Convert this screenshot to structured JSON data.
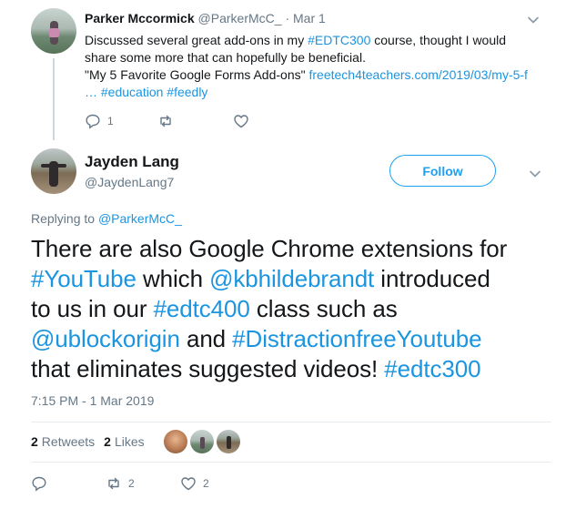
{
  "parent_tweet": {
    "author_name": "Parker Mccormick",
    "author_handle": "@ParkerMcC_",
    "separator": "·",
    "date": "Mar 1",
    "text_lines": [
      {
        "parts": [
          {
            "t": "Discussed several great add-ons in my ",
            "link": false
          },
          {
            "t": "#EDTC300",
            "link": true
          },
          {
            "t": " course, thought I would",
            "link": false
          }
        ]
      },
      {
        "parts": [
          {
            "t": "share some more that can hopefully be beneficial.",
            "link": false
          }
        ]
      },
      {
        "parts": [
          {
            "t": "\"My 5 Favorite Google Forms Add-ons\" ",
            "link": false
          },
          {
            "t": "freetech4teachers.com/2019/03/my-5-f",
            "link": true
          }
        ]
      },
      {
        "parts": [
          {
            "t": "… #education #feedly",
            "link": true
          }
        ]
      }
    ],
    "reply_count": "1",
    "retweet_count": "",
    "like_count": ""
  },
  "main_tweet": {
    "author_name": "Jayden Lang",
    "author_handle": "@JaydenLang7",
    "follow_label": "Follow",
    "replying_prefix": "Replying to ",
    "replying_handle": "@ParkerMcC_",
    "text_lines": [
      {
        "parts": [
          {
            "t": "There are also Google Chrome extensions for",
            "link": false
          }
        ]
      },
      {
        "parts": [
          {
            "t": "#YouTube",
            "link": true
          },
          {
            "t": " which ",
            "link": false
          },
          {
            "t": "@kbhildebrandt",
            "link": true
          },
          {
            "t": " introduced",
            "link": false
          }
        ]
      },
      {
        "parts": [
          {
            "t": "to us in our ",
            "link": false
          },
          {
            "t": "#edtc400",
            "link": true
          },
          {
            "t": " class such as",
            "link": false
          }
        ]
      },
      {
        "parts": [
          {
            "t": "@ublockorigin",
            "link": true
          },
          {
            "t": " and ",
            "link": false
          },
          {
            "t": "#DistractionfreeYoutube",
            "link": true
          }
        ]
      },
      {
        "parts": [
          {
            "t": "that eliminates suggested videos! ",
            "link": false
          },
          {
            "t": "#edtc300",
            "link": true
          }
        ]
      }
    ],
    "timestamp": "7:15 PM - 1 Mar 2019",
    "retweets_count": "2",
    "retweets_label": "Retweets",
    "likes_count": "2",
    "likes_label": "Likes",
    "action_retweet_count": "2",
    "action_like_count": "2",
    "liker_avatars": [
      "liker-avatar-1",
      "liker-avatar-2",
      "liker-avatar-3"
    ]
  },
  "icons": {
    "reply": "reply-icon",
    "retweet": "retweet-icon",
    "like": "heart-icon",
    "menu": "chevron-down-icon"
  },
  "colors": {
    "link": "#1b95e0",
    "muted": "#657786",
    "text": "#14171a",
    "follow_border": "#1da1f2",
    "divider": "#e6ecf0",
    "thread_line": "#ccd6dd"
  }
}
